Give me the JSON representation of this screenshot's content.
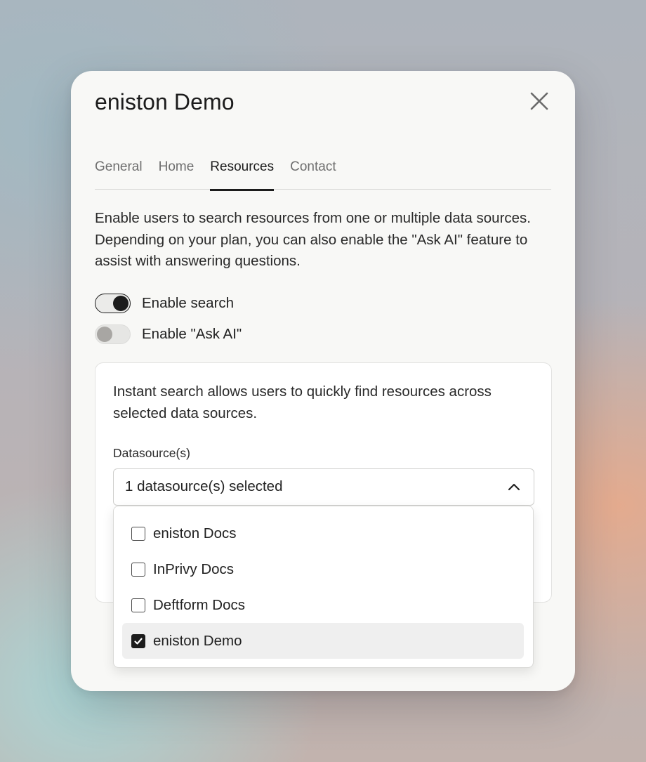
{
  "dialog": {
    "title": "eniston Demo",
    "close_icon": "close-icon"
  },
  "tabs": [
    {
      "label": "General",
      "active": false
    },
    {
      "label": "Home",
      "active": false
    },
    {
      "label": "Resources",
      "active": true
    },
    {
      "label": "Contact",
      "active": false
    }
  ],
  "resources": {
    "description": "Enable users to search resources from one or multiple data sources. Depending on your plan, you can also enable the \"Ask AI\" feature to assist with answering questions.",
    "toggles": [
      {
        "label": "Enable search",
        "on": true
      },
      {
        "label": "Enable \"Ask AI\"",
        "on": false
      }
    ],
    "panel": {
      "text": "Instant search allows users to quickly find resources across selected data sources.",
      "field_label": "Datasource(s)",
      "select_value": "1 datasource(s) selected",
      "select_icon": "chevron-up-icon",
      "options": [
        {
          "label": "eniston Docs",
          "checked": false
        },
        {
          "label": "InPrivy Docs",
          "checked": false
        },
        {
          "label": "Deftform Docs",
          "checked": false
        },
        {
          "label": "eniston Demo",
          "checked": true
        }
      ]
    }
  },
  "colors": {
    "accent": "#1c1c1c",
    "dialog_bg": "#f8f8f6",
    "selected_option_bg": "#efefef"
  }
}
